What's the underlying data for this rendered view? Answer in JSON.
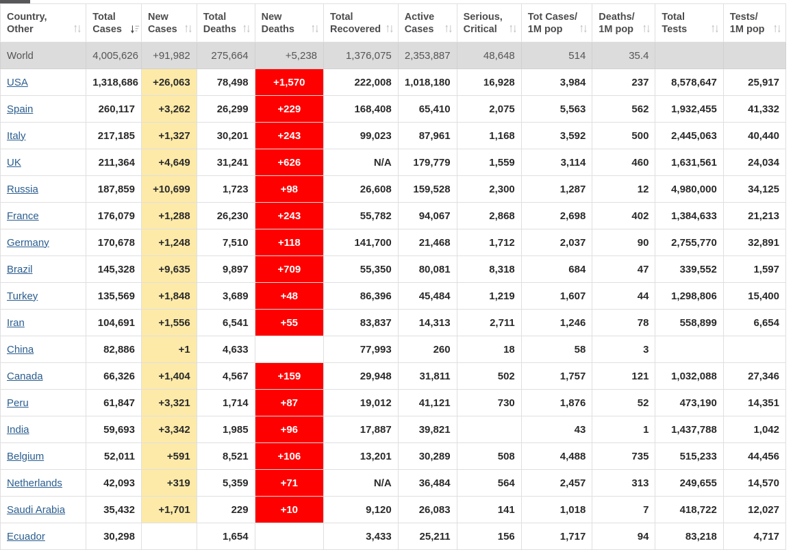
{
  "table": {
    "columns": [
      {
        "label": "Country,\nOther",
        "sort": "both",
        "name": "country-other"
      },
      {
        "label": "Total\nCases",
        "sort": "desc",
        "name": "total-cases"
      },
      {
        "label": "New\nCases",
        "sort": "both",
        "name": "new-cases"
      },
      {
        "label": "Total\nDeaths",
        "sort": "both",
        "name": "total-deaths"
      },
      {
        "label": "New\nDeaths",
        "sort": "both",
        "name": "new-deaths"
      },
      {
        "label": "Total\nRecovered",
        "sort": "both",
        "name": "total-recovered"
      },
      {
        "label": "Active\nCases",
        "sort": "both",
        "name": "active-cases"
      },
      {
        "label": "Serious,\nCritical",
        "sort": "both",
        "name": "serious-critical"
      },
      {
        "label": "Tot Cases/\n1M pop",
        "sort": "both",
        "name": "tot-cases-per-1m"
      },
      {
        "label": "Deaths/\n1M pop",
        "sort": "both",
        "name": "deaths-per-1m"
      },
      {
        "label": "Total\nTests",
        "sort": "both",
        "name": "total-tests"
      },
      {
        "label": "Tests/\n1M pop",
        "sort": "both",
        "name": "tests-per-1m"
      }
    ],
    "rows": [
      {
        "country": "World",
        "is_world": true,
        "link": false,
        "cells": [
          "4,005,626",
          "+91,982",
          "275,664",
          "+5,238",
          "1,376,075",
          "2,353,887",
          "48,648",
          "514",
          "35.4",
          "",
          ""
        ]
      },
      {
        "country": "USA",
        "is_world": false,
        "link": true,
        "cells": [
          "1,318,686",
          "+26,063",
          "78,498",
          "+1,570",
          "222,008",
          "1,018,180",
          "16,928",
          "3,984",
          "237",
          "8,578,647",
          "25,917"
        ]
      },
      {
        "country": "Spain",
        "is_world": false,
        "link": true,
        "cells": [
          "260,117",
          "+3,262",
          "26,299",
          "+229",
          "168,408",
          "65,410",
          "2,075",
          "5,563",
          "562",
          "1,932,455",
          "41,332"
        ]
      },
      {
        "country": "Italy",
        "is_world": false,
        "link": true,
        "cells": [
          "217,185",
          "+1,327",
          "30,201",
          "+243",
          "99,023",
          "87,961",
          "1,168",
          "3,592",
          "500",
          "2,445,063",
          "40,440"
        ]
      },
      {
        "country": "UK",
        "is_world": false,
        "link": true,
        "cells": [
          "211,364",
          "+4,649",
          "31,241",
          "+626",
          "N/A",
          "179,779",
          "1,559",
          "3,114",
          "460",
          "1,631,561",
          "24,034"
        ]
      },
      {
        "country": "Russia",
        "is_world": false,
        "link": true,
        "cells": [
          "187,859",
          "+10,699",
          "1,723",
          "+98",
          "26,608",
          "159,528",
          "2,300",
          "1,287",
          "12",
          "4,980,000",
          "34,125"
        ]
      },
      {
        "country": "France",
        "is_world": false,
        "link": true,
        "cells": [
          "176,079",
          "+1,288",
          "26,230",
          "+243",
          "55,782",
          "94,067",
          "2,868",
          "2,698",
          "402",
          "1,384,633",
          "21,213"
        ]
      },
      {
        "country": "Germany",
        "is_world": false,
        "link": true,
        "cells": [
          "170,678",
          "+1,248",
          "7,510",
          "+118",
          "141,700",
          "21,468",
          "1,712",
          "2,037",
          "90",
          "2,755,770",
          "32,891"
        ]
      },
      {
        "country": "Brazil",
        "is_world": false,
        "link": true,
        "cells": [
          "145,328",
          "+9,635",
          "9,897",
          "+709",
          "55,350",
          "80,081",
          "8,318",
          "684",
          "47",
          "339,552",
          "1,597"
        ]
      },
      {
        "country": "Turkey",
        "is_world": false,
        "link": true,
        "cells": [
          "135,569",
          "+1,848",
          "3,689",
          "+48",
          "86,396",
          "45,484",
          "1,219",
          "1,607",
          "44",
          "1,298,806",
          "15,400"
        ]
      },
      {
        "country": "Iran",
        "is_world": false,
        "link": true,
        "cells": [
          "104,691",
          "+1,556",
          "6,541",
          "+55",
          "83,837",
          "14,313",
          "2,711",
          "1,246",
          "78",
          "558,899",
          "6,654"
        ]
      },
      {
        "country": "China",
        "is_world": false,
        "link": true,
        "cells": [
          "82,886",
          "+1",
          "4,633",
          "",
          "77,993",
          "260",
          "18",
          "58",
          "3",
          "",
          ""
        ]
      },
      {
        "country": "Canada",
        "is_world": false,
        "link": true,
        "cells": [
          "66,326",
          "+1,404",
          "4,567",
          "+159",
          "29,948",
          "31,811",
          "502",
          "1,757",
          "121",
          "1,032,088",
          "27,346"
        ]
      },
      {
        "country": "Peru",
        "is_world": false,
        "link": true,
        "cells": [
          "61,847",
          "+3,321",
          "1,714",
          "+87",
          "19,012",
          "41,121",
          "730",
          "1,876",
          "52",
          "473,190",
          "14,351"
        ]
      },
      {
        "country": "India",
        "is_world": false,
        "link": true,
        "cells": [
          "59,693",
          "+3,342",
          "1,985",
          "+96",
          "17,887",
          "39,821",
          "",
          "43",
          "1",
          "1,437,788",
          "1,042"
        ]
      },
      {
        "country": "Belgium",
        "is_world": false,
        "link": true,
        "cells": [
          "52,011",
          "+591",
          "8,521",
          "+106",
          "13,201",
          "30,289",
          "508",
          "4,488",
          "735",
          "515,233",
          "44,456"
        ]
      },
      {
        "country": "Netherlands",
        "is_world": false,
        "link": true,
        "cells": [
          "42,093",
          "+319",
          "5,359",
          "+71",
          "N/A",
          "36,484",
          "564",
          "2,457",
          "313",
          "249,655",
          "14,570"
        ]
      },
      {
        "country": "Saudi Arabia",
        "is_world": false,
        "link": true,
        "cells": [
          "35,432",
          "+1,701",
          "229",
          "+10",
          "9,120",
          "26,083",
          "141",
          "1,018",
          "7",
          "418,722",
          "12,027"
        ]
      },
      {
        "country": "Ecuador",
        "is_world": false,
        "link": true,
        "cells": [
          "30,298",
          "",
          "1,654",
          "",
          "3,433",
          "25,211",
          "156",
          "1,717",
          "94",
          "83,218",
          "4,717"
        ]
      }
    ]
  },
  "colors": {
    "new_cases_highlight": "#fdeaa8",
    "new_deaths_highlight": "#fe0000",
    "world_row_background": "#dcdcdc",
    "link": "#2a5d8f",
    "border": "#dfdfdf"
  }
}
